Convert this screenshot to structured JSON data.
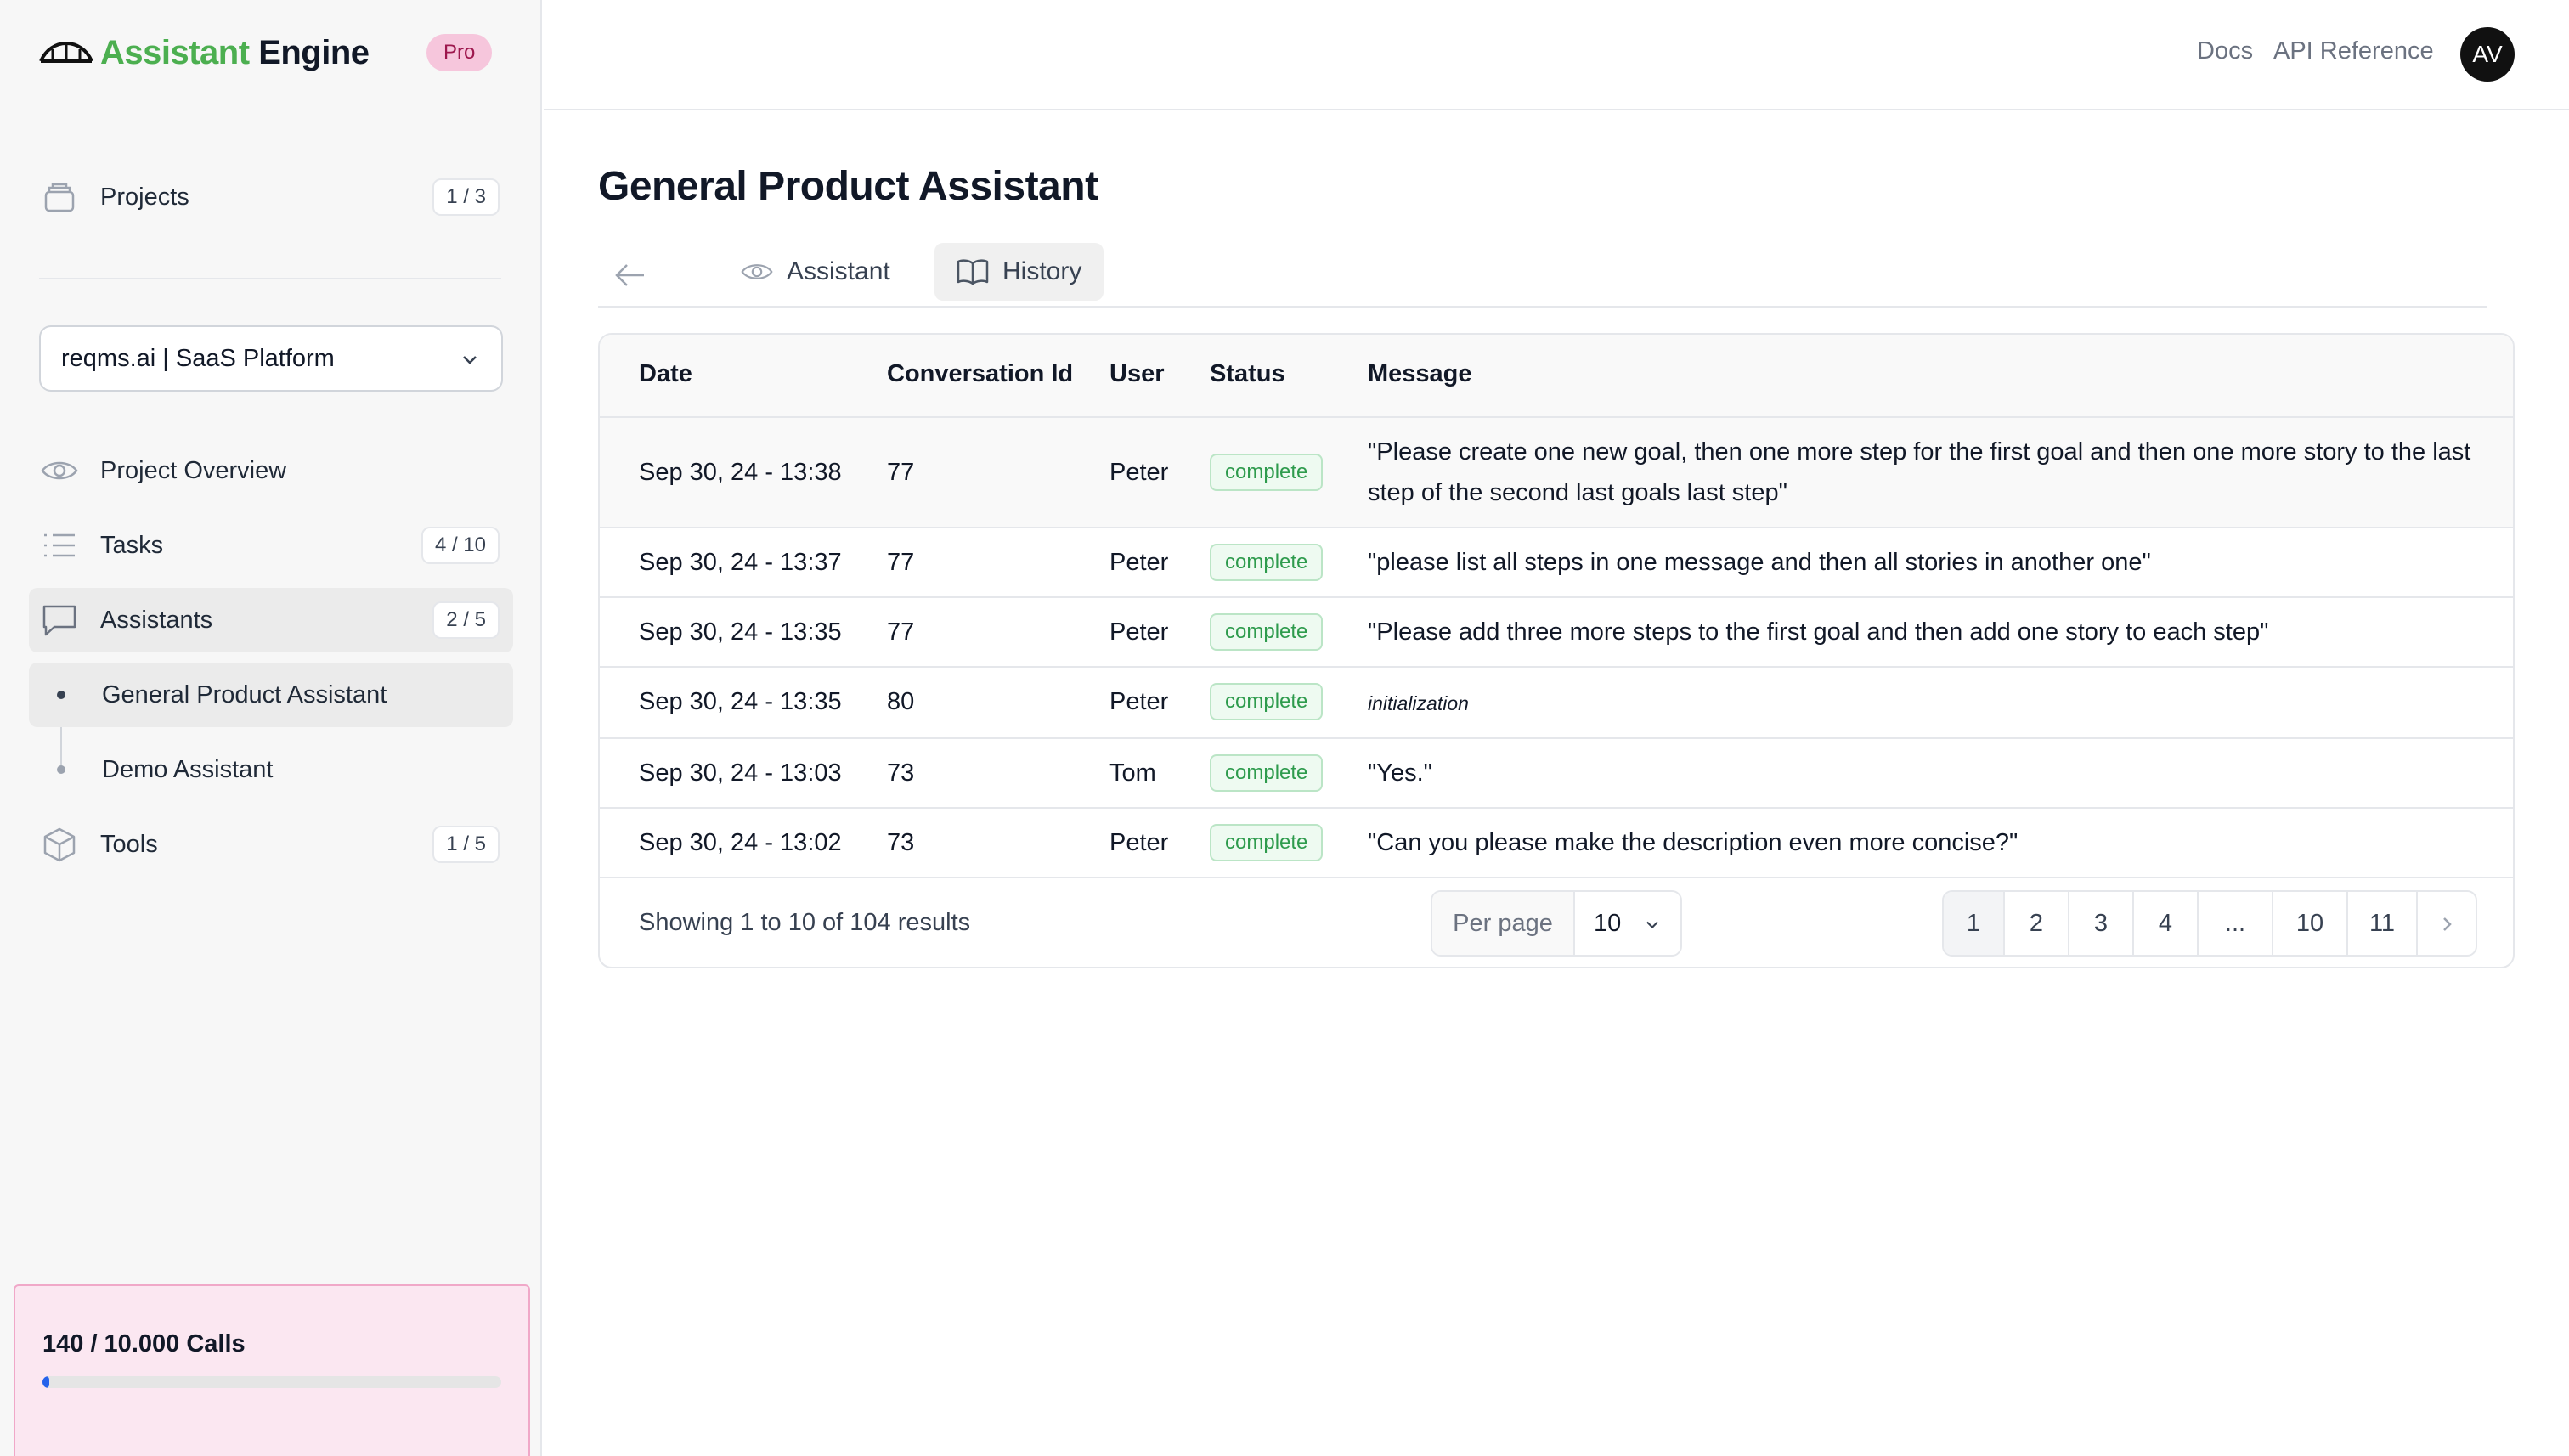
{
  "brand": {
    "name_part1": "Assistant",
    "name_part2": "Engine",
    "plan_badge": "Pro"
  },
  "sidebar": {
    "projects": {
      "label": "Projects",
      "count": "1 / 3"
    },
    "project_select": {
      "value": "reqms.ai | SaaS Platform"
    },
    "items": [
      {
        "label": "Project Overview",
        "icon": "eye-icon"
      },
      {
        "label": "Tasks",
        "count": "4 / 10",
        "icon": "list-icon"
      },
      {
        "label": "Assistants",
        "count": "2 / 5",
        "icon": "chat-bubble-icon"
      },
      {
        "label": "Tools",
        "count": "1 / 5",
        "icon": "cube-icon"
      }
    ],
    "assistants": [
      {
        "label": "General Product Assistant"
      },
      {
        "label": "Demo Assistant"
      }
    ],
    "usage": {
      "label": "140 / 10.000 Calls",
      "progress": 0.014,
      "bar_color": "#2563eb"
    }
  },
  "header": {
    "links": [
      "Docs",
      "API Reference"
    ],
    "avatar_initials": "AV"
  },
  "main": {
    "title": "General Product Assistant",
    "tabs": [
      {
        "label": "Assistant",
        "icon": "eye-icon"
      },
      {
        "label": "History",
        "icon": "book-icon",
        "active": true
      }
    ],
    "table": {
      "columns": [
        "Date",
        "Conversation Id",
        "User",
        "Status",
        "Message"
      ],
      "rows": [
        {
          "date": "Sep 30, 24 - 13:38",
          "conversation_id": "77",
          "user": "Peter",
          "status": "complete",
          "message": "\"Please create one new goal, then one more step for the first goal and then one more story to the last step of the second last goals last step\""
        },
        {
          "date": "Sep 30, 24 - 13:37",
          "conversation_id": "77",
          "user": "Peter",
          "status": "complete",
          "message": "\"please list all steps in one message and then all stories in another one\""
        },
        {
          "date": "Sep 30, 24 - 13:35",
          "conversation_id": "77",
          "user": "Peter",
          "status": "complete",
          "message": "\"Please add three more steps to the first goal and then add one story to each step\""
        },
        {
          "date": "Sep 30, 24 - 13:35",
          "conversation_id": "80",
          "user": "Peter",
          "status": "complete",
          "message": "initialization"
        },
        {
          "date": "Sep 30, 24 - 13:03",
          "conversation_id": "73",
          "user": "Tom",
          "status": "complete",
          "message": "\"Yes.\""
        },
        {
          "date": "Sep 30, 24 - 13:02",
          "conversation_id": "73",
          "user": "Peter",
          "status": "complete",
          "message": "\"Can you please make the description even more concise?\""
        }
      ]
    },
    "footer": {
      "results_text": "Showing 1 to 10 of 104 results",
      "per_page_label": "Per page",
      "per_page_value": "10",
      "pages": [
        "1",
        "2",
        "3",
        "4",
        "...",
        "10",
        "11"
      ],
      "current_page": "1"
    }
  },
  "colors": {
    "brand_green": "#4caf50",
    "status_green": "#2e9b4d",
    "pro_pink": "#f6c6dc"
  }
}
